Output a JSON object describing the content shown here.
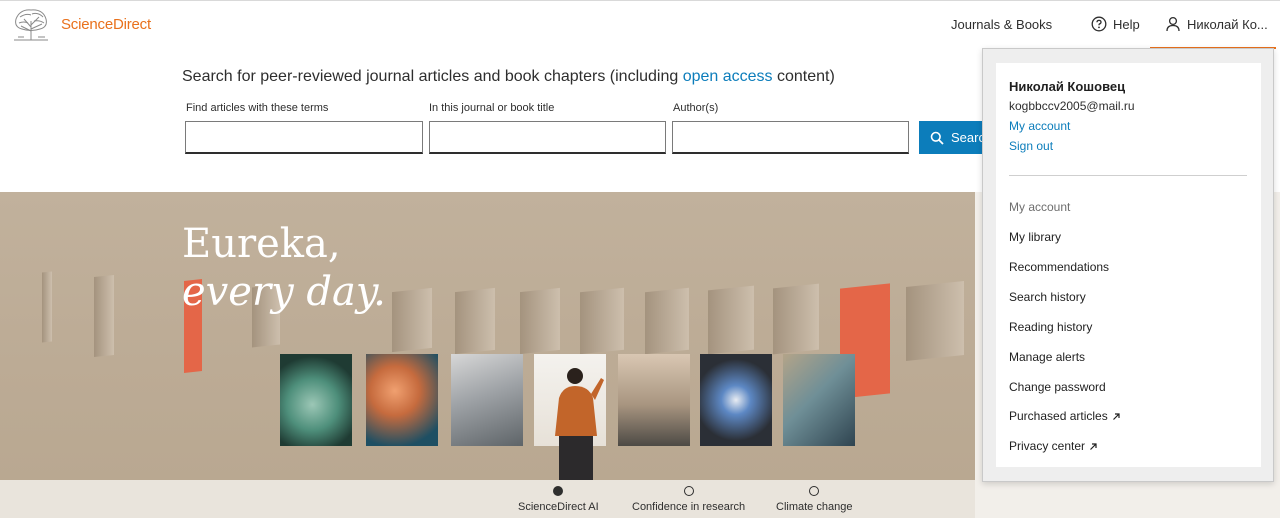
{
  "header": {
    "brand": "ScienceDirect",
    "journals_books": "Journals & Books",
    "help": "Help",
    "user_short": "Николай Ко..."
  },
  "search": {
    "headline_prefix": "Search for peer-reviewed journal articles and book chapters (including ",
    "headline_link": "open access",
    "headline_suffix": " content)",
    "terms_label": "Find articles with these terms",
    "journal_label": "In this journal or book title",
    "author_label": "Author(s)",
    "button_label": "Search"
  },
  "hero": {
    "line1": "Eureka,",
    "line2": "every day."
  },
  "carousel": {
    "items": [
      {
        "label": "ScienceDirect AI",
        "active": true
      },
      {
        "label": "Confidence in research",
        "active": false
      },
      {
        "label": "Climate change",
        "active": false
      }
    ]
  },
  "account_menu": {
    "name": "Николай Кошовец",
    "email": "kogbbccv2005@mail.ru",
    "my_account_link": "My account",
    "sign_out_link": "Sign out",
    "section_title": "My account",
    "items": [
      {
        "label": "My library",
        "external": false
      },
      {
        "label": "Recommendations",
        "external": false
      },
      {
        "label": "Search history",
        "external": false
      },
      {
        "label": "Reading history",
        "external": false
      },
      {
        "label": "Manage alerts",
        "external": false
      },
      {
        "label": "Change password",
        "external": false
      },
      {
        "label": "Purchased articles",
        "external": true
      },
      {
        "label": "Privacy center",
        "external": true
      }
    ]
  },
  "colors": {
    "brand_orange": "#e9711c",
    "link_blue": "#0c7dbb",
    "hero_bg": "#bcab95",
    "accent_red": "#e46648"
  }
}
